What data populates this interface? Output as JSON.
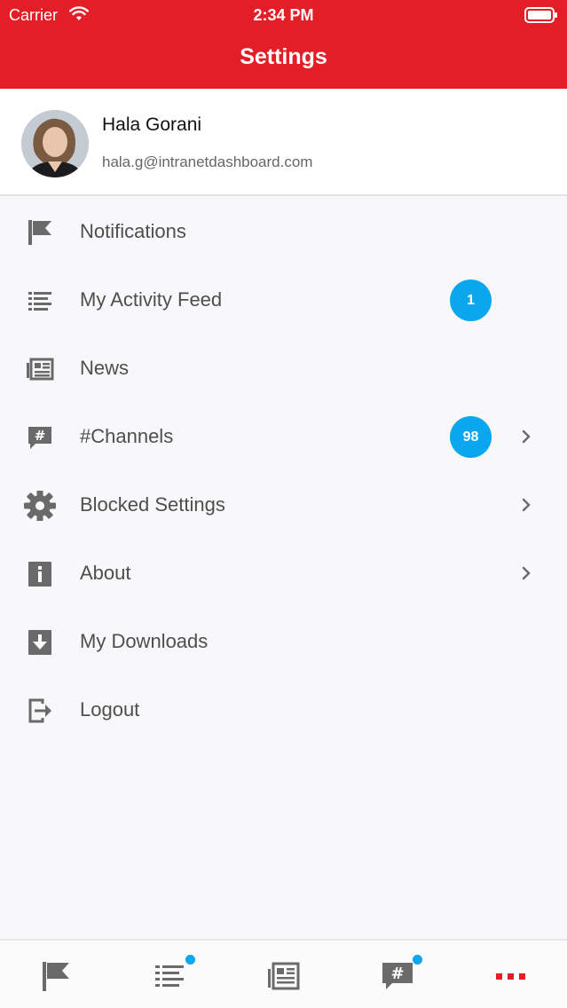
{
  "status_bar": {
    "carrier": "Carrier",
    "time": "2:34 PM"
  },
  "header": {
    "title": "Settings"
  },
  "profile": {
    "name": "Hala Gorani",
    "email": "hala.g@intranetdashboard.com"
  },
  "menu": {
    "items": [
      {
        "label": "Notifications",
        "icon": "flag-icon"
      },
      {
        "label": "My Activity Feed",
        "icon": "list-icon",
        "badge": "1"
      },
      {
        "label": "News",
        "icon": "newspaper-icon"
      },
      {
        "label": "#Channels",
        "icon": "channels-icon",
        "badge": "98"
      },
      {
        "label": "Blocked Settings",
        "icon": "gear-icon"
      },
      {
        "label": "About",
        "icon": "info-icon"
      },
      {
        "label": "My Downloads",
        "icon": "download-icon"
      },
      {
        "label": "Logout",
        "icon": "logout-icon"
      }
    ]
  },
  "tabbar": {
    "tabs": [
      {
        "icon": "flag-icon"
      },
      {
        "icon": "list-icon",
        "has_dot": true
      },
      {
        "icon": "newspaper-icon"
      },
      {
        "icon": "channels-icon",
        "has_dot": true
      },
      {
        "icon": "more-icon",
        "active": true
      }
    ]
  },
  "colors": {
    "brand_red": "#e31e26",
    "badge_blue": "#0aa6ee",
    "icon_gray": "#6a6a6a"
  }
}
